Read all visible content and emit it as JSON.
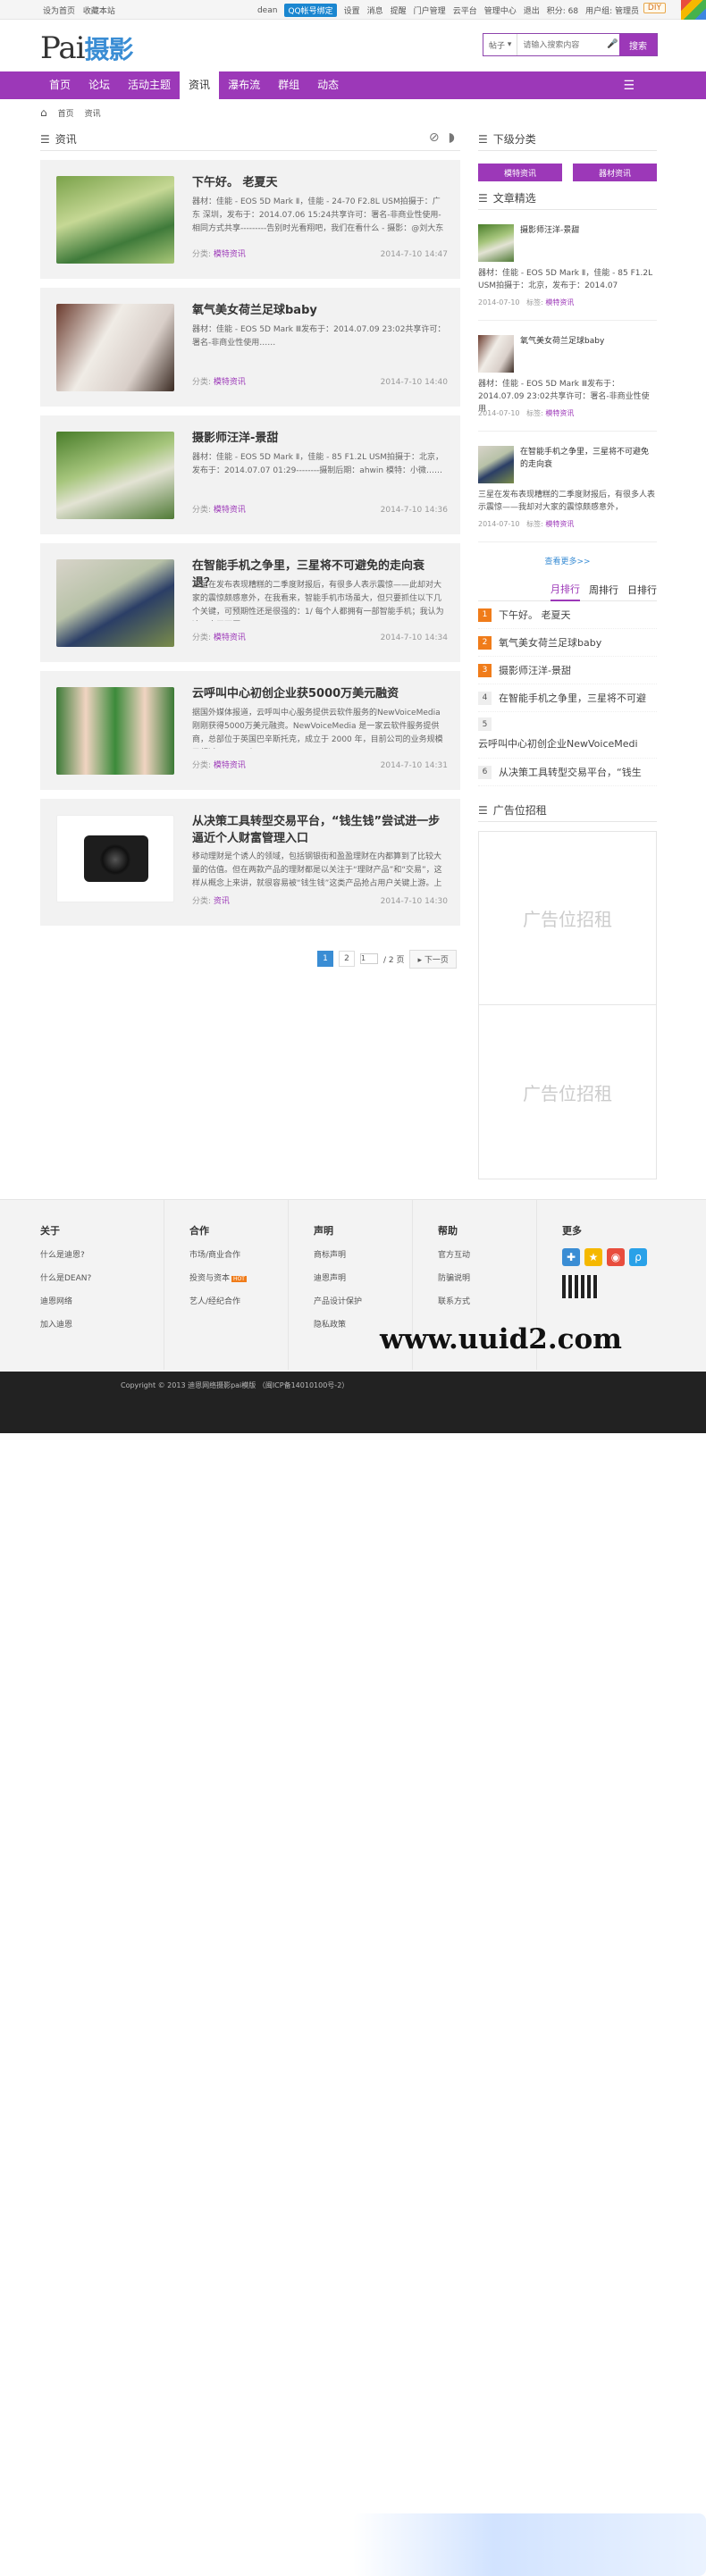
{
  "topbar": {
    "left": [
      "设为首页",
      "收藏本站"
    ],
    "user": "dean",
    "qq": "QQ帐号绑定",
    "links": [
      "设置",
      "消息",
      "提醒",
      "门户管理",
      "云平台",
      "管理中心",
      "退出",
      "积分: 68",
      "用户组: 管理员"
    ],
    "diy": "DIY"
  },
  "header": {
    "logo_a": "Pai",
    "logo_b": "摄影",
    "search_type": "帖子",
    "search_placeholder": "请输入搜索内容",
    "search_button": "搜索"
  },
  "nav": {
    "items": [
      "首页",
      "论坛",
      "活动主题",
      "资讯",
      "瀑布流",
      "群组",
      "动态"
    ],
    "active": "资讯"
  },
  "crumb": {
    "home": "首页",
    "current": "资讯"
  },
  "main": {
    "title": "资讯",
    "articles": [
      {
        "title": "下午好。 老夏天",
        "summary": "器材：佳能 - EOS 5D Mark Ⅱ，佳能 - 24-70 F2.8L USM拍摄于：广东 深圳，发布于：2014.07.06 15:24共享许可：署名-非商业性使用-相同方式共享---------告别时光看翔吧，我们在看什么 - 摄影：@刘大东 http ……",
        "cat_label": "分类:",
        "cat": "模特资讯",
        "date": "2014-7-10 14:47"
      },
      {
        "title": "氧气美女荷兰足球baby",
        "summary": "器材：佳能 - EOS 5D Mark Ⅲ发布于：2014.07.09 23:02共享许可：署名-非商业性使用……",
        "cat_label": "分类:",
        "cat": "模特资讯",
        "date": "2014-7-10 14:40"
      },
      {
        "title": "摄影师汪洋-景甜",
        "summary": "器材：佳能 - EOS 5D Mark Ⅱ，佳能 - 85 F1.2L USM拍摄于：北京，发布于：2014.07.07 01:29--------摄制后期：ahwin 模特：小微……",
        "cat_label": "分类:",
        "cat": "模特资讯",
        "date": "2014-7-10 14:36"
      },
      {
        "title": "在智能手机之争里，三星将不可避免的走向衰退？",
        "summary": "三星在发布表现糟糕的二季度财报后，有很多人表示震惊——此却对大家的震惊颇感意外，在我看来，智能手机市场虽大，但只要抓住以下几个关键，可预期性还是很强的：1/ 每个人都拥有一部智能手机；我认为这一点无可厚……",
        "cat_label": "分类:",
        "cat": "模特资讯",
        "date": "2014-7-10 14:34"
      },
      {
        "title": "云呼叫中心初创企业获5000万美元融资",
        "summary": "据国外媒体报道，云呼叫中心服务提供云软件服务的NewVoiceMedia刚刚获得5000万美元融资。NewVoiceMedia 是一家云软件服务提供商，总部位于英国巴辛斯托克，成立于 2000 年，目前公司的业务规模已超过 13000 个。NewV……",
        "cat_label": "分类:",
        "cat": "模特资讯",
        "date": "2014-7-10 14:31"
      },
      {
        "title": "从决策工具转型交易平台，“钱生钱”尝试进一步逼近个人财富管理入口",
        "summary": "移动理财是个诱人的领域，包括钢银街和盈盈理财在内都算到了比较大量的估值。但在两款产品的理财都是以关注于“理财产品”和“交易”，这样从概念上来讲，就很容易被“钱生钱”这类产品抢占用户关键上游。上次我们……",
        "cat_label": "分类:",
        "cat": "资讯",
        "date": "2014-7-10 14:30"
      }
    ],
    "pager": {
      "pages": [
        "1",
        "2"
      ],
      "current": "1",
      "input": "1",
      "total": "/ 2 页",
      "next": "下一页"
    }
  },
  "side": {
    "sub_title": "下级分类",
    "sub_buttons": [
      "模特资讯",
      "器材资讯"
    ],
    "picks_title": "文章精选",
    "picks": [
      {
        "title": "摄影师汪洋-景甜",
        "summary": "器材：佳能 - EOS 5D Mark Ⅱ，佳能 - 85 F1.2L USM拍摄于：北京，发布于：2014.07",
        "date": "2014-07-10",
        "tag_label": "标签:",
        "tag": "模特资讯"
      },
      {
        "title": "氧气美女荷兰足球baby",
        "summary": "器材：佳能 - EOS 5D Mark Ⅲ发布于：2014.07.09 23:02共享许可：署名-非商业性使用",
        "date": "2014-07-10",
        "tag_label": "标签:",
        "tag": "模特资讯"
      },
      {
        "title": "在智能手机之争里，三星将不可避免的走向衰",
        "summary": "三星在发布表现糟糕的二季度财报后，有很多人表示震惊——我却对大家的震惊颇感意外，",
        "date": "2014-07-10",
        "tag_label": "标签:",
        "tag": "模特资讯"
      }
    ],
    "more": "查看更多>>",
    "rank_tabs": [
      "月排行",
      "周排行",
      "日排行"
    ],
    "rank": [
      {
        "n": "1",
        "t": "下午好。 老夏天"
      },
      {
        "n": "2",
        "t": "氧气美女荷兰足球baby"
      },
      {
        "n": "3",
        "t": "摄影师汪洋-景甜"
      },
      {
        "n": "4",
        "t": "在智能手机之争里，三星将不可避"
      },
      {
        "n": "5",
        "t": "云呼叫中心初创企业NewVoiceMedi"
      },
      {
        "n": "6",
        "t": "从决策工具转型交易平台，“钱生"
      }
    ],
    "ad_title": "广告位招租",
    "ads": [
      "广告位招租",
      "广告位招租"
    ]
  },
  "footer": {
    "cols": [
      {
        "title": "关于",
        "items": [
          "什么是迪恩?",
          "什么是DEAN?",
          "迪恩网络",
          "加入迪恩"
        ]
      },
      {
        "title": "合作",
        "items": [
          "市场/商业合作",
          "投资与资本",
          "艺人/经纪合作"
        ],
        "hot": "HOT"
      },
      {
        "title": "声明",
        "items": [
          "商标声明",
          "迪恩声明",
          "产品设计保护",
          "隐私政策"
        ]
      },
      {
        "title": "帮助",
        "items": [
          "官方互动",
          "防骗说明",
          "联系方式"
        ]
      },
      {
        "title": "更多",
        "items": []
      }
    ],
    "copyright": "Copyright © 2013 迪恩网络摄影pai模版 （闽ICP备14010100号-2）",
    "watermark": "www.uuid2.com"
  },
  "colors": {
    "accent": "#9c38b8",
    "link": "#3a8dd4",
    "hot": "#f07c1a"
  }
}
